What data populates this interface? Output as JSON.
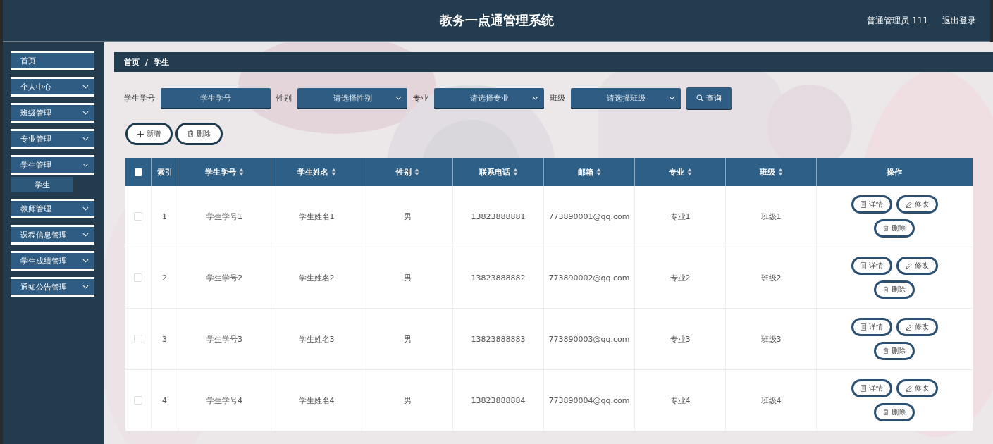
{
  "header": {
    "title": "教务一点通管理系统",
    "user": "普通管理员 111",
    "logout": "退出登录"
  },
  "sidebar": {
    "items": [
      {
        "kind": "link",
        "label": "首页"
      },
      {
        "kind": "group",
        "label": "个人中心",
        "expanded": false
      },
      {
        "kind": "group",
        "label": "班级管理",
        "expanded": false
      },
      {
        "kind": "group",
        "label": "专业管理",
        "expanded": false
      },
      {
        "kind": "group",
        "label": "学生管理",
        "expanded": true,
        "children": [
          {
            "label": "学生",
            "selected": true
          }
        ]
      },
      {
        "kind": "group",
        "label": "教师管理",
        "expanded": false
      },
      {
        "kind": "group",
        "label": "课程信息管理",
        "expanded": false
      },
      {
        "kind": "group",
        "label": "学生成绩管理",
        "expanded": false
      },
      {
        "kind": "group",
        "label": "通知公告管理",
        "expanded": false
      }
    ]
  },
  "breadcrumb": {
    "items": [
      "首页",
      "学生"
    ],
    "separator": "/"
  },
  "filters": [
    {
      "kind": "input",
      "label": "学生学号",
      "placeholder": "学生学号"
    },
    {
      "kind": "select",
      "label": "性别",
      "placeholder": "请选择性别"
    },
    {
      "kind": "select",
      "label": "专业",
      "placeholder": "请选择专业"
    },
    {
      "kind": "select",
      "label": "班级",
      "placeholder": "请选择班级"
    }
  ],
  "search_button": "查询",
  "toolbar": [
    {
      "kind": "add",
      "label": "新增"
    },
    {
      "kind": "delete",
      "label": "删除"
    }
  ],
  "table": {
    "all_checked": false,
    "columns": [
      {
        "label": "索引",
        "sortable": false
      },
      {
        "label": "学生学号",
        "sortable": true
      },
      {
        "label": "学生姓名",
        "sortable": true
      },
      {
        "label": "性别",
        "sortable": true
      },
      {
        "label": "联系电话",
        "sortable": true
      },
      {
        "label": "邮箱",
        "sortable": true
      },
      {
        "label": "专业",
        "sortable": true
      },
      {
        "label": "班级",
        "sortable": true
      },
      {
        "label": "操作",
        "sortable": false
      }
    ],
    "rows": [
      {
        "checked": false,
        "cells": [
          "1",
          "学生学号1",
          "学生姓名1",
          "男",
          "13823888881",
          "773890001@qq.com",
          "专业1",
          "班级1"
        ],
        "actions": [
          {
            "kind": "detail",
            "label": "详情"
          },
          {
            "kind": "edit",
            "label": "修改"
          },
          {
            "kind": "delete",
            "label": "删除"
          }
        ]
      },
      {
        "checked": false,
        "cells": [
          "2",
          "学生学号2",
          "学生姓名2",
          "男",
          "13823888882",
          "773890002@qq.com",
          "专业2",
          "班级2"
        ],
        "actions": [
          {
            "kind": "detail",
            "label": "详情"
          },
          {
            "kind": "edit",
            "label": "修改"
          },
          {
            "kind": "delete",
            "label": "删除"
          }
        ]
      },
      {
        "checked": false,
        "cells": [
          "3",
          "学生学号3",
          "学生姓名3",
          "男",
          "13823888883",
          "773890003@qq.com",
          "专业3",
          "班级3"
        ],
        "actions": [
          {
            "kind": "detail",
            "label": "详情"
          },
          {
            "kind": "edit",
            "label": "修改"
          },
          {
            "kind": "delete",
            "label": "删除"
          }
        ]
      },
      {
        "checked": false,
        "cells": [
          "4",
          "学生学号4",
          "学生姓名4",
          "男",
          "13823888884",
          "773890004@qq.com",
          "专业4",
          "班级4"
        ],
        "actions": [
          {
            "kind": "detail",
            "label": "详情"
          },
          {
            "kind": "edit",
            "label": "修改"
          },
          {
            "kind": "delete",
            "label": "删除"
          }
        ]
      }
    ]
  }
}
